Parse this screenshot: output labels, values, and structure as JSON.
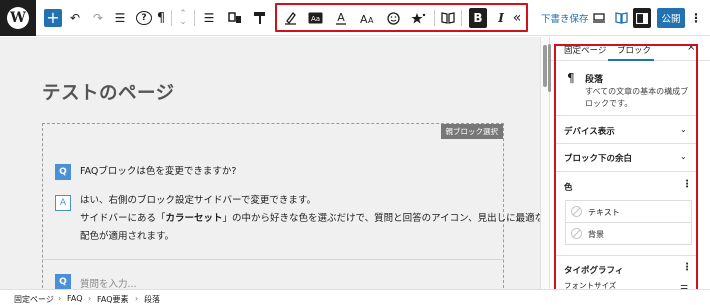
{
  "toolbar": {
    "logo_letter": "W",
    "add_block": "+",
    "undo": "↶",
    "redo": "↷",
    "list_view": "☰",
    "help": "?",
    "paragraph": "¶",
    "move": "⌃",
    "align": "☰",
    "bold": "B",
    "italic": "I",
    "more": "«",
    "save_draft": "下書き保存",
    "publish": "公開",
    "format_icons": [
      "pen-icon",
      "text-box-icon",
      "text-color-icon",
      "font-size-icon",
      "emoji-icon",
      "star-icon"
    ]
  },
  "editor": {
    "page_title": "テストのページ",
    "parent_select": "親ブロック選択",
    "faq": [
      {
        "q_badge": "Q",
        "question": "FAQブロックは色を変更できますか?",
        "a_badge": "A",
        "answer_line1": "はい、右側のブロック設定サイドバーで変更できます。",
        "answer_line2_pre": "サイドバーにある「",
        "answer_line2_bold": "カラーセット",
        "answer_line2_post": "」の中から好きな色を選ぶだけで、質問と回答のアイコン、見出しに最適な",
        "answer_line3": "配色が適用されます。"
      }
    ],
    "next_q_badge": "Q",
    "question_placeholder": "質問を入力..."
  },
  "sidebar": {
    "tabs": [
      "固定ページ",
      "ブロック"
    ],
    "active_tab": "ブロック",
    "close": "×",
    "block_icon": "¶",
    "block_title": "段落",
    "block_desc": "すべての文章の基本の構成ブロックです。",
    "panels": {
      "device": "デバイス表示",
      "margin": "ブロック下の余白",
      "color": "色",
      "text_color": "テキスト",
      "background": "背景",
      "typography": "タイポグラフィ",
      "font_size": "フォントサイズ"
    }
  },
  "breadcrumb": [
    "固定ページ",
    "FAQ",
    "FAQ要素",
    "段落"
  ],
  "colors": {
    "accent": "#2271b1",
    "highlight": "#d0101c",
    "faq_blue": "#4a90d9",
    "dark": "#1e1e1e"
  }
}
